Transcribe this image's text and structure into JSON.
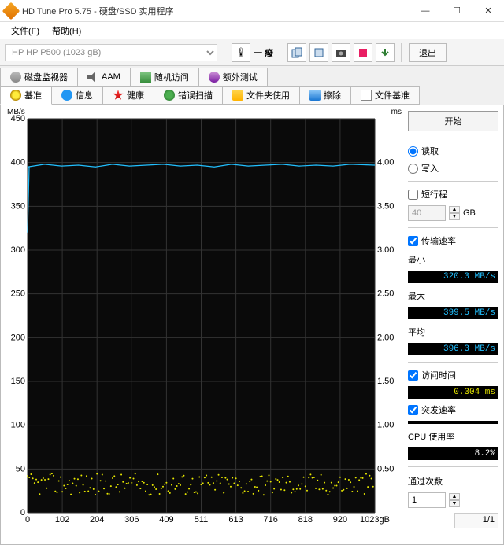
{
  "window": {
    "title": "HD Tune Pro 5.75 - 硬盘/SSD 实用程序"
  },
  "menu": {
    "file": "文件(F)",
    "help": "帮助(H)"
  },
  "toolbar": {
    "drive": "HP    HP P500 (1023 gB)",
    "exit": "退出"
  },
  "tabs_top": {
    "monitor": "磁盘监视器",
    "aam": "AAM",
    "random": "随机访问",
    "extra": "额外测试"
  },
  "tabs": {
    "benchmark": "基准",
    "info": "信息",
    "health": "健康",
    "errorscan": "错误扫描",
    "folderusage": "文件夹使用",
    "erase": "擦除",
    "filebench": "文件基准"
  },
  "chart": {
    "left_label": "MB/s",
    "right_label": "ms",
    "y_left": [
      "450",
      "400",
      "350",
      "300",
      "250",
      "200",
      "150",
      "100",
      "50",
      "0"
    ],
    "y_right": [
      "4.00",
      "3.50",
      "3.00",
      "2.50",
      "2.00",
      "1.50",
      "1.00",
      "0.50"
    ],
    "x_ticks": [
      "0",
      "102",
      "204",
      "306",
      "409",
      "511",
      "613",
      "716",
      "818",
      "920",
      "1023gB"
    ]
  },
  "chart_data": {
    "type": "line+scatter",
    "title": "",
    "xlabel": "gB",
    "ylabel_left": "MB/s",
    "ylabel_right": "ms",
    "x_range": [
      0,
      1023
    ],
    "y_left_range": [
      0,
      450
    ],
    "y_right_range": [
      0,
      4.5
    ],
    "series": [
      {
        "name": "transfer_rate",
        "axis": "left",
        "style": "line",
        "color": "#22c0ff",
        "x": [
          0,
          50,
          100,
          150,
          200,
          250,
          300,
          350,
          400,
          450,
          500,
          550,
          600,
          650,
          700,
          750,
          800,
          850,
          900,
          950,
          1023
        ],
        "y": [
          395,
          398,
          396,
          397,
          395,
          398,
          396,
          397,
          398,
          396,
          397,
          395,
          398,
          396,
          397,
          398,
          396,
          397,
          396,
          398,
          397
        ]
      },
      {
        "name": "access_time",
        "axis": "right",
        "style": "scatter",
        "color": "#e8e800",
        "approx_y_mean": 0.304,
        "approx_y_spread": [
          0.2,
          0.45
        ],
        "count": 200
      }
    ]
  },
  "side": {
    "start": "开始",
    "read": "读取",
    "write": "写入",
    "shortstroke": "短行程",
    "shortstroke_val": "40",
    "shortstroke_unit": "GB",
    "transfer": "传输速率",
    "min_lbl": "最小",
    "min_val": "320.3 MB/s",
    "max_lbl": "最大",
    "max_val": "399.5 MB/s",
    "avg_lbl": "平均",
    "avg_val": "396.3 MB/s",
    "access_lbl": "访问时间",
    "access_val": "0.304 ms",
    "burst_lbl": "突发速率",
    "burst_val": "",
    "cpu_lbl": "CPU 使用率",
    "cpu_val": "8.2%",
    "passes_lbl": "通过次数",
    "passes_val": "1",
    "passes_of": "1/1"
  }
}
